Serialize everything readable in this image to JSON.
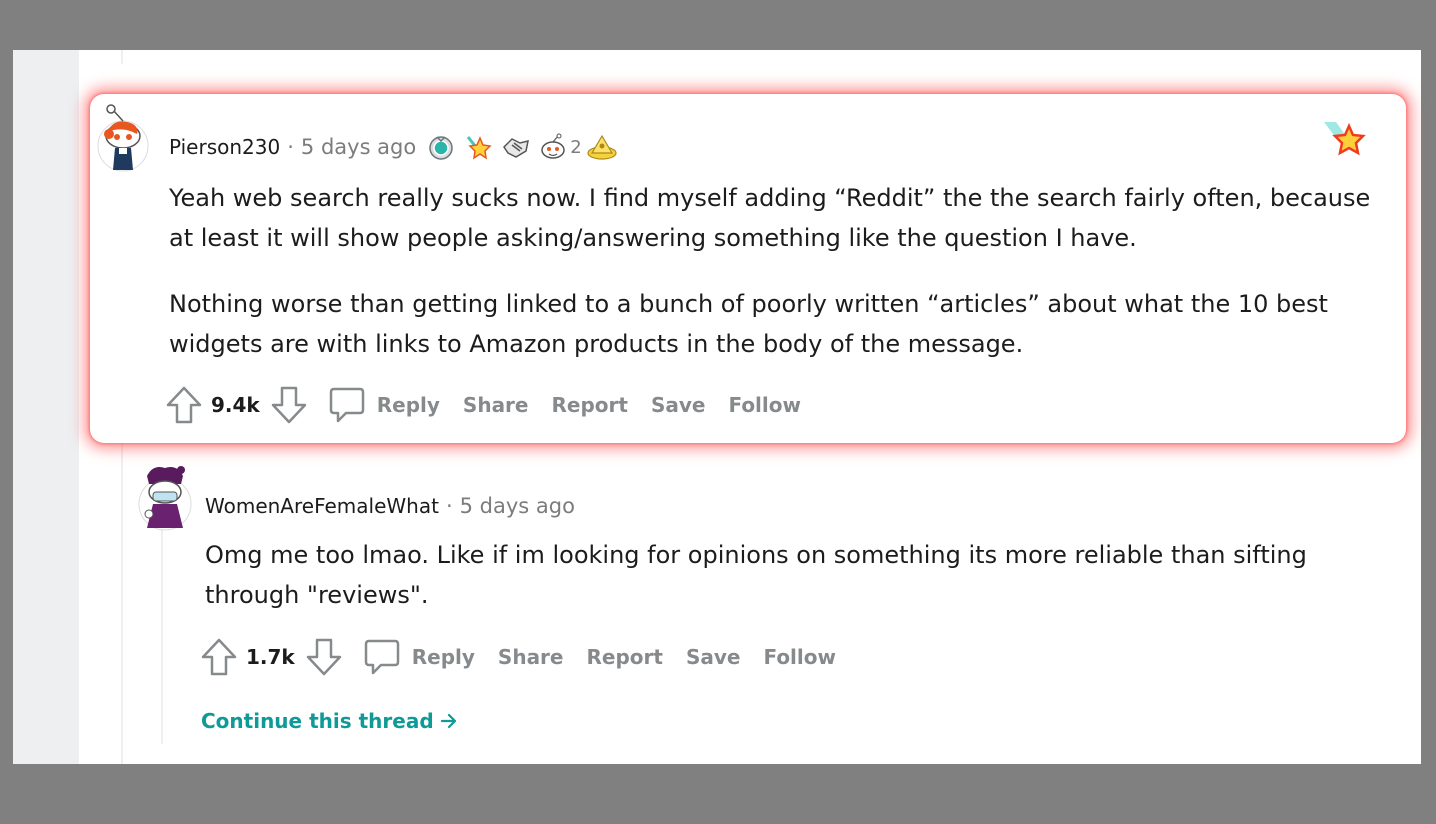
{
  "colors": {
    "background": "#808080",
    "surface": "#ffffff",
    "text": "#1c1c1c",
    "meta": "#7c7c7c",
    "action": "#878a8c",
    "link": "#0e9a96",
    "highlight_glow": "#ff4646"
  },
  "comment": {
    "username": "Pierson230",
    "separator": "·",
    "timestamp": "5 days ago",
    "awards": [
      {
        "icon": "silver-medal-award-icon"
      },
      {
        "icon": "starstruck-award-icon"
      },
      {
        "icon": "handshake-award-icon"
      },
      {
        "icon": "wholesome-snoo-award-icon",
        "count": "2"
      },
      {
        "icon": "gold-pyramid-award-icon"
      }
    ],
    "paragraphs": [
      "Yeah web search really sucks now. I find myself adding “Reddit” the the search fairly often, because at least it will show people asking/answering something like the question I have.",
      "Nothing worse than getting linked to a bunch of poorly written “articles” about what the 10 best widgets are with links to Amazon products in the body of the message."
    ],
    "score": "9.4k",
    "actions": {
      "reply": "Reply",
      "share": "Share",
      "report": "Report",
      "save": "Save",
      "follow": "Follow"
    }
  },
  "reply": {
    "username": "WomenAreFemaleWhat",
    "separator": "·",
    "timestamp": "5 days ago",
    "paragraphs": [
      "Omg me too lmao. Like if im looking for opinions on something its more reliable than sifting through \"reviews\"."
    ],
    "score": "1.7k",
    "actions": {
      "reply": "Reply",
      "share": "Share",
      "report": "Report",
      "save": "Save",
      "follow": "Follow"
    },
    "continue_label": "Continue this thread"
  }
}
